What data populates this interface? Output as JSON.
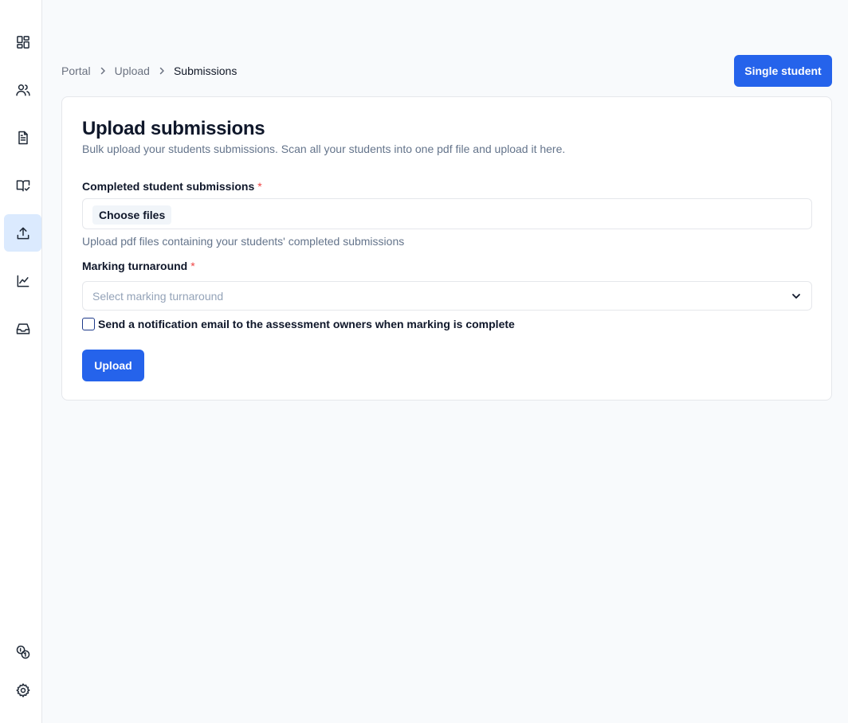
{
  "sidebar": {
    "items": [
      {
        "icon": "dashboard-icon",
        "active": false
      },
      {
        "icon": "users-icon",
        "active": false
      },
      {
        "icon": "document-icon",
        "active": false
      },
      {
        "icon": "book-check-icon",
        "active": false
      },
      {
        "icon": "upload-icon",
        "active": true
      },
      {
        "icon": "chart-icon",
        "active": false
      },
      {
        "icon": "inbox-icon",
        "active": false
      }
    ],
    "bottom_items": [
      {
        "icon": "coins-icon"
      },
      {
        "icon": "gear-icon"
      }
    ]
  },
  "breadcrumb": {
    "items": [
      "Portal",
      "Upload",
      "Submissions"
    ]
  },
  "header": {
    "single_student_label": "Single student"
  },
  "card": {
    "title": "Upload submissions",
    "description": "Bulk upload your students submissions. Scan all your students into one pdf file and upload it here.",
    "files_field": {
      "label": "Completed student submissions",
      "required_mark": "*",
      "button_label": "Choose files",
      "help": "Upload pdf files containing your students' completed submissions"
    },
    "turnaround_field": {
      "label": "Marking turnaround",
      "required_mark": "*",
      "placeholder": "Select marking turnaround"
    },
    "notify_checkbox": {
      "label": "Send a notification email to the assessment owners when marking is complete",
      "checked": false
    },
    "upload_label": "Upload"
  },
  "colors": {
    "primary": "#2563eb",
    "active_nav": "#dbeafe",
    "required": "#ef4444"
  }
}
